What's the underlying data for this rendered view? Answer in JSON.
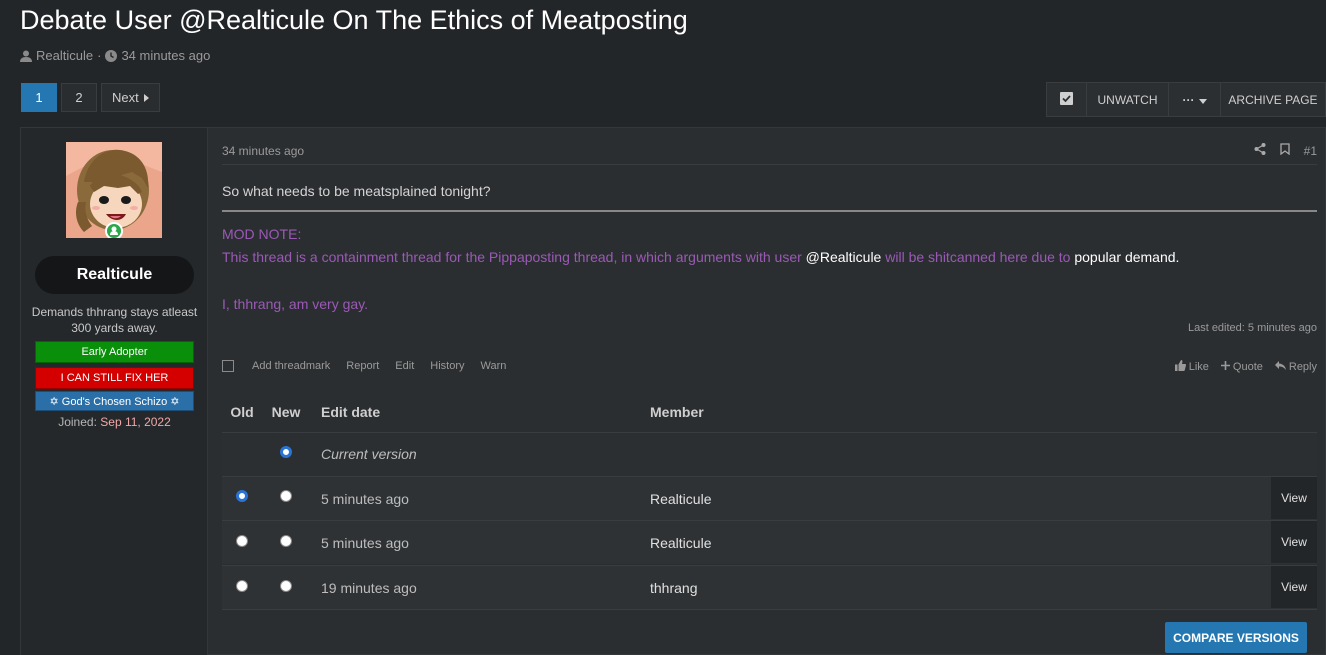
{
  "thread": {
    "title": "Debate User @Realticule On The Ethics of Meatposting",
    "author": "Realticule",
    "separator": "·",
    "time": "34 minutes ago"
  },
  "pagination": {
    "pages": [
      "1",
      "2"
    ],
    "current": "1",
    "next_label": "Next"
  },
  "toolbar": {
    "unwatch_label": "UNWATCH",
    "more_label": "···",
    "archive_label": "ARCHIVE PAGE"
  },
  "user": {
    "name": "Realticule",
    "title": "Demands thhrang stays atleast 300 yards away.",
    "banners": [
      {
        "label": "Early Adopter",
        "color": "#0a8f0a"
      },
      {
        "label": "I CAN STILL FIX HER",
        "color": "#d40000"
      },
      {
        "label": "✡ God's Chosen Schizo ✡",
        "color": "#2b6fa8"
      }
    ],
    "joined_label": "Joined:",
    "joined_value": "Sep 11, 2022"
  },
  "post": {
    "time": "34 minutes ago",
    "number": "#1",
    "text": "So what needs to be meatsplained tonight?",
    "mod_note_label": "MOD NOTE:",
    "mod_line_1a": "This thread is a containment thread for the Pippaposting thread, in which arguments with user ",
    "mod_line_1b": "@Realticule",
    "mod_line_1c": " will be shitcanned here due to ",
    "mod_line_1d": "popular demand.",
    "mod_line_2": "I, thhrang, am very gay.",
    "last_edited": "Last edited: 5 minutes ago"
  },
  "actions": {
    "left": [
      "Add threadmark",
      "Report",
      "Edit",
      "History",
      "Warn"
    ],
    "like": "Like",
    "quote": "Quote",
    "reply": "Reply"
  },
  "history": {
    "headers": {
      "old": "Old",
      "new": "New",
      "date": "Edit date",
      "member": "Member"
    },
    "current_label": "Current version",
    "rows": [
      {
        "date": "5 minutes ago",
        "member": "Realticule",
        "view": "View"
      },
      {
        "date": "5 minutes ago",
        "member": "Realticule",
        "view": "View"
      },
      {
        "date": "19 minutes ago",
        "member": "thhrang",
        "view": "View"
      }
    ],
    "compare_label": "COMPARE VERSIONS"
  },
  "colors": {
    "accent": "#2577b1",
    "mod_note": "#9b59b6",
    "joined_date": "#f2a7a7"
  }
}
